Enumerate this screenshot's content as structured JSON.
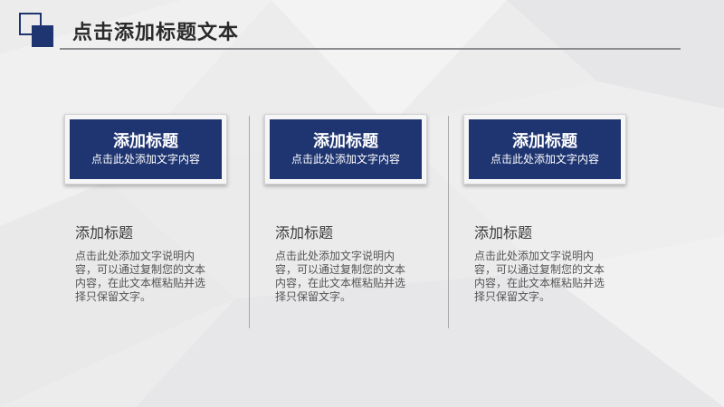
{
  "slide": {
    "title": "点击添加标题文本",
    "accent_color": "#1f3571"
  },
  "columns": [
    {
      "card_title": "添加标题",
      "card_subtitle": "点击此处添加文字内容",
      "heading": "添加标题",
      "body": "点击此处添加文字说明内容，可以通过复制您的文本内容，在此文本框粘贴并选择只保留文字。"
    },
    {
      "card_title": "添加标题",
      "card_subtitle": "点击此处添加文字内容",
      "heading": "添加标题",
      "body": "点击此处添加文字说明内容，可以通过复制您的文本内容，在此文本框粘贴并选择只保留文字。"
    },
    {
      "card_title": "添加标题",
      "card_subtitle": "点击此处添加文字内容",
      "heading": "添加标题",
      "body": "点击此处添加文字说明内容，可以通过复制您的文本内容，在此文本框粘贴并选择只保留文字。"
    }
  ]
}
